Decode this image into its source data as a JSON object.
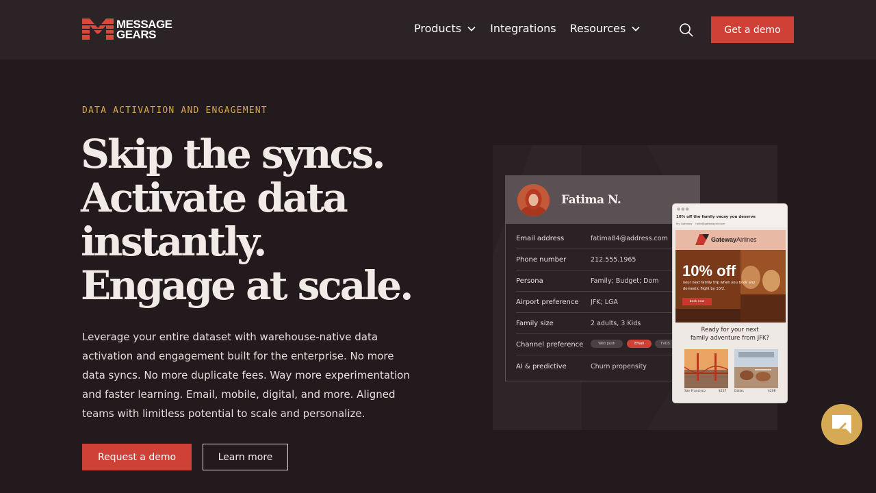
{
  "header": {
    "logo_line1": "MESSAGE",
    "logo_line2": "GEARS",
    "nav": [
      {
        "label": "Products",
        "has_menu": true
      },
      {
        "label": "Integrations",
        "has_menu": false
      },
      {
        "label": "Resources",
        "has_menu": true
      }
    ],
    "search_icon": "search-icon",
    "cta_label": "Get a demo"
  },
  "hero": {
    "eyebrow": "DATA ACTIVATION AND ENGAGEMENT",
    "headline_lines": [
      "Skip the syncs.",
      "Activate data",
      "instantly.",
      "Engage at scale."
    ],
    "lede": "Leverage your entire dataset with warehouse-native data activation and engagement built for the enterprise. No more data syncs. No more duplicate fees. Way more experimentation and faster learning. Email, mobile, digital, and more. Aligned teams with limitless potential to scale and personalize.",
    "primary_cta": "Request a demo",
    "secondary_cta": "Learn more"
  },
  "profile": {
    "name": "Fatima N.",
    "rows": [
      {
        "key": "Email address",
        "value": "fatima84@address.com"
      },
      {
        "key": "Phone number",
        "value": "212.555.1965"
      },
      {
        "key": "Persona",
        "value": "Family; Budget; Dom"
      },
      {
        "key": "Airport preference",
        "value": "JFK; LGA"
      },
      {
        "key": "Family size",
        "value": "2 adults, 3 Kids"
      },
      {
        "key": "Channel preference",
        "value": ""
      },
      {
        "key": "AI & predictive",
        "value": "Churn propensity"
      }
    ],
    "channels": [
      "Web push",
      "Email",
      "TVOS"
    ]
  },
  "email": {
    "subject": "10% off the family vacay you deserve",
    "from_name": "My Gateway",
    "from_address": "hello@gatewayair.com",
    "brand_bold": "Gateway",
    "brand_rest": "Airlines",
    "offer": "10% off",
    "offer_sub": "your next family trip when you book any domestic flight by 10/2.",
    "book_label": "book now",
    "ready_line1": "Ready for your next",
    "ready_line2": "family adventure from JFK?",
    "destinations": [
      {
        "city": "San Francisco",
        "price": "$237"
      },
      {
        "city": "Dallas",
        "price": "$206"
      }
    ]
  },
  "colors": {
    "background": "#221a1d",
    "header": "#2c2326",
    "accent": "#cf4037",
    "eyebrow": "#d6a64a",
    "chat": "#d6aa55"
  }
}
